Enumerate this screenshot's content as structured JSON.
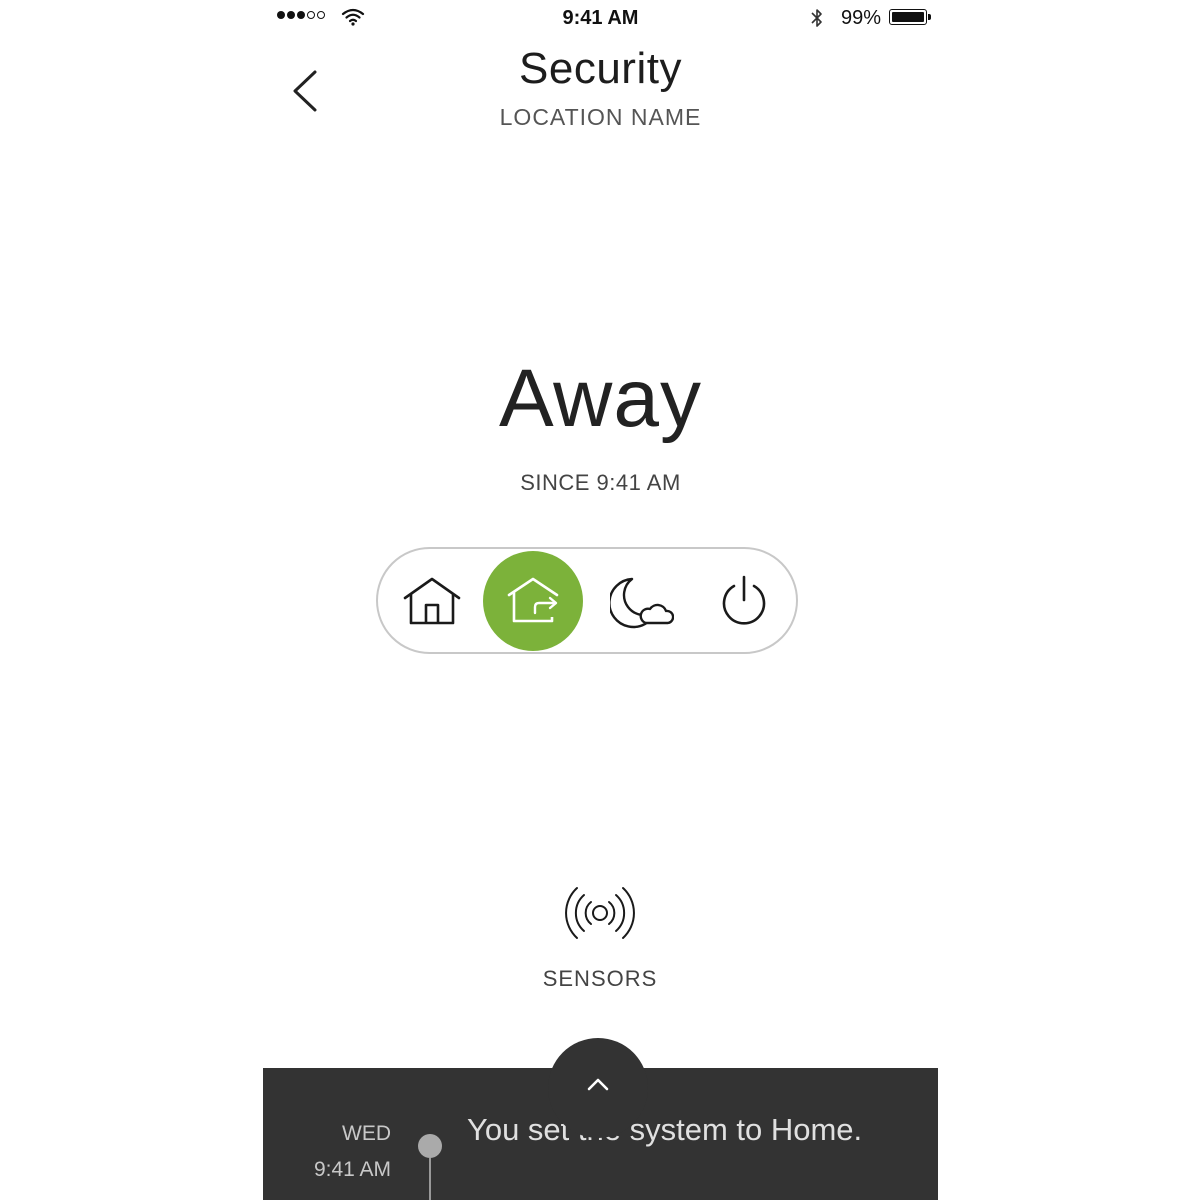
{
  "status_bar": {
    "time": "9:41 AM",
    "battery_percent": "99%",
    "signal_bars_filled": 3,
    "signal_bars_total": 5
  },
  "header": {
    "title": "Security",
    "subtitle": "LOCATION NAME",
    "back_icon": "chevron-left-icon"
  },
  "mode": {
    "current": "Away",
    "since": "SINCE 9:41 AM",
    "accent_color": "#7cb23a",
    "options": [
      {
        "id": "home",
        "icon": "home-icon",
        "active": false
      },
      {
        "id": "away",
        "icon": "away-icon",
        "active": true
      },
      {
        "id": "night",
        "icon": "night-icon",
        "active": false
      },
      {
        "id": "off",
        "icon": "power-icon",
        "active": false
      }
    ]
  },
  "sensors": {
    "label": "SENSORS",
    "icon": "sensors-icon"
  },
  "activity": {
    "expand_icon": "chevron-up-icon",
    "day": "WED",
    "time": "9:41 AM",
    "message": "You set the system to Home.",
    "background": "#333333"
  }
}
